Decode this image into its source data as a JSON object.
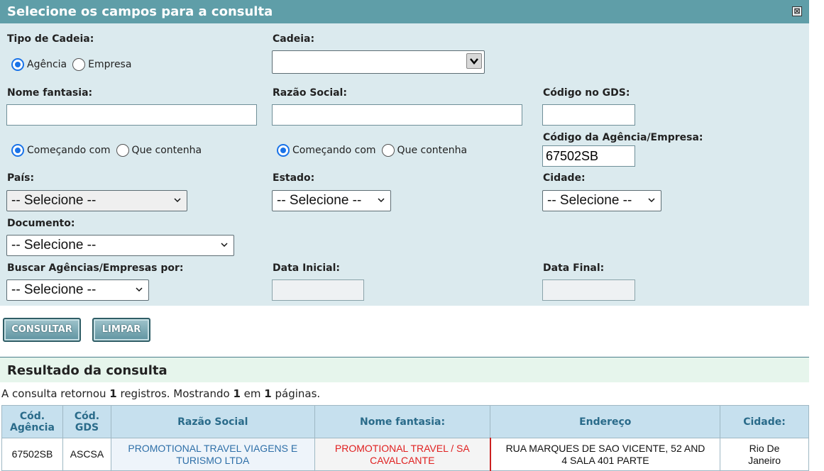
{
  "panel": {
    "title": "Selecione os campos para a consulta",
    "close_glyph": "⊠"
  },
  "form": {
    "tipo_cadeia": {
      "label": "Tipo de Cadeia:",
      "options": [
        "Agência",
        "Empresa"
      ],
      "selected": "Agência"
    },
    "cadeia": {
      "label": "Cadeia:",
      "value": ""
    },
    "nome_fantasia": {
      "label": "Nome fantasia:",
      "value": "",
      "match_options": [
        "Começando com",
        "Que contenha"
      ],
      "match_selected": "Começando com"
    },
    "razao_social": {
      "label": "Razão Social:",
      "value": "",
      "match_options": [
        "Começando com",
        "Que contenha"
      ],
      "match_selected": "Começando com"
    },
    "codigo_gds": {
      "label": "Código no GDS:",
      "value": ""
    },
    "codigo_agencia": {
      "label": "Código da Agência/Empresa:",
      "value": "67502SB"
    },
    "pais": {
      "label": "País:",
      "value": "-- Selecione --"
    },
    "estado": {
      "label": "Estado:",
      "value": "-- Selecione --"
    },
    "cidade": {
      "label": "Cidade:",
      "value": "-- Selecione --"
    },
    "documento": {
      "label": "Documento:",
      "value": "-- Selecione --"
    },
    "buscar_por": {
      "label": "Buscar Agências/Empresas por:",
      "value": "-- Selecione --"
    },
    "data_inicial": {
      "label": "Data Inicial:",
      "value": ""
    },
    "data_final": {
      "label": "Data Final:",
      "value": ""
    }
  },
  "actions": {
    "consultar": "CONSULTAR",
    "limpar": "LIMPAR"
  },
  "results": {
    "title": "Resultado da consulta",
    "summary": {
      "prefix": "A consulta retornou ",
      "count": "1",
      "mid1": " registros. Mostrando ",
      "shown": "1",
      "mid2": " em ",
      "pages": "1",
      "suffix": " páginas."
    },
    "columns": {
      "cod_agencia": [
        "Cód.",
        "Agência"
      ],
      "cod_gds": [
        "Cód.",
        "GDS"
      ],
      "razao_social": "Razão Social",
      "nome_fantasia": "Nome fantasia:",
      "endereco": "Endereço",
      "cidade": "Cidade:"
    },
    "rows": [
      {
        "cod_agencia": "67502SB",
        "cod_gds": "ASCSA",
        "razao_social": [
          "PROMOTIONAL TRAVEL VIAGENS E",
          "TURISMO LTDA"
        ],
        "nome_fantasia": [
          "PROMOTIONAL TRAVEL / SA",
          "CAVALCANTE"
        ],
        "endereco": [
          "RUA MARQUES DE SAO VICENTE, 52 AND",
          "4 SALA 401 PARTE"
        ],
        "cidade": [
          "Rio De",
          "Janeiro"
        ]
      }
    ]
  },
  "colors": {
    "header_bg": "#5f9ea8",
    "panel_bg": "#dbeaee",
    "radio_accent": "#1a73e8",
    "link_blue": "#2e6fa8",
    "highlight_red": "#e02020",
    "results_bar_bg": "#e6f5ec"
  }
}
